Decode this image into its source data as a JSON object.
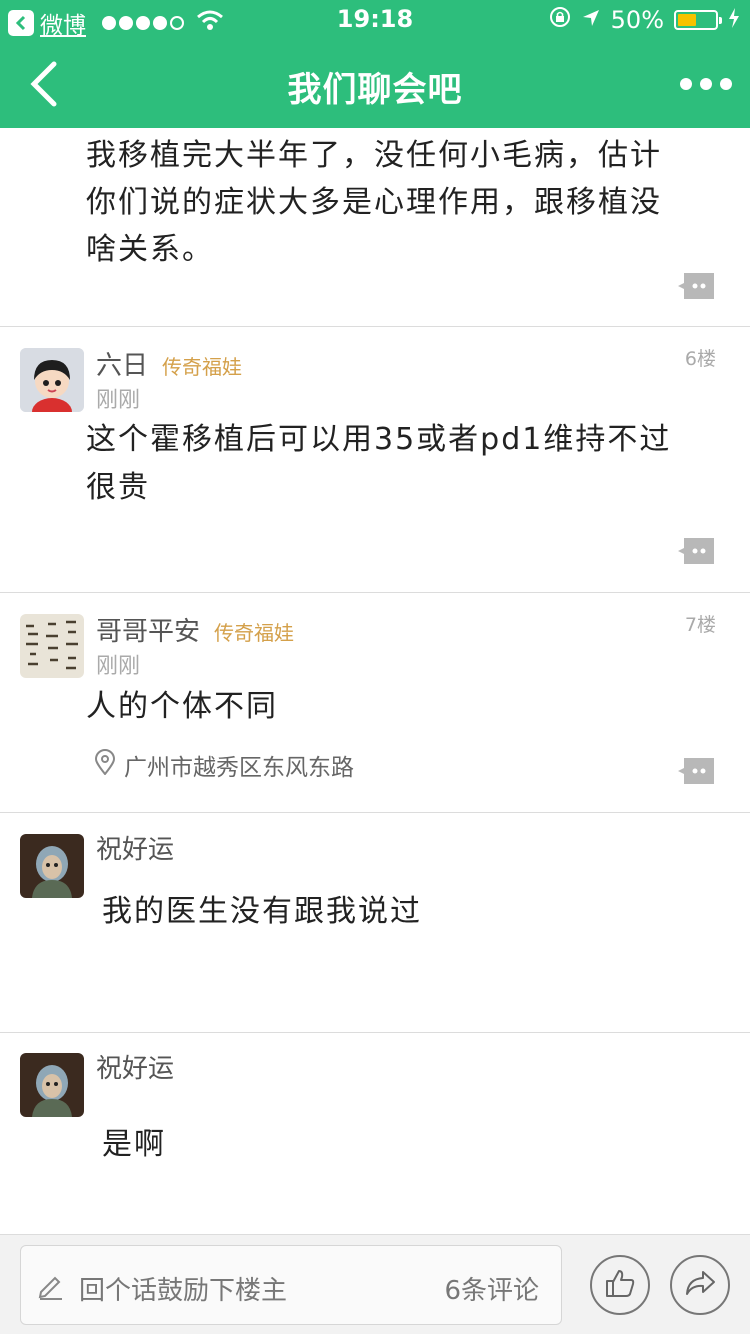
{
  "status_bar": {
    "back_app": "微博",
    "time": "19:18",
    "battery": "50%"
  },
  "nav": {
    "title": "我们聊会吧"
  },
  "posts": [
    {
      "text": "我移植完大半年了，没任何小毛病，估计你们说的症状大多是心理作用，跟移植没啥关系。"
    },
    {
      "user": "六日",
      "badge": "传奇福娃",
      "time": "刚刚",
      "floor": "6楼",
      "text": "这个霍移植后可以用35或者pd1维持不过很贵"
    },
    {
      "user": "哥哥平安",
      "badge": "传奇福娃",
      "time": "刚刚",
      "floor": "7楼",
      "text": "人的个体不同",
      "location": "广州市越秀区东风东路"
    },
    {
      "user": "祝好运",
      "text": "我的医生没有跟我说过"
    },
    {
      "user": "祝好运",
      "text": "是啊"
    }
  ],
  "bottom_bar": {
    "reply_placeholder": "回个话鼓励下楼主",
    "comment_count": "6条评论"
  },
  "colors": {
    "brand_green": "#2dbe7c",
    "badge_gold": "#d4a04a",
    "battery_yellow": "#f7c200"
  },
  "icons": [
    "back-app-icon",
    "wifi-icon",
    "lock-rotation-icon",
    "location-arrow-icon",
    "battery-icon",
    "charging-icon",
    "back-icon",
    "more-icon",
    "comment-icon",
    "location-pin-icon",
    "pencil-icon",
    "thumbs-up-icon",
    "share-icon"
  ]
}
